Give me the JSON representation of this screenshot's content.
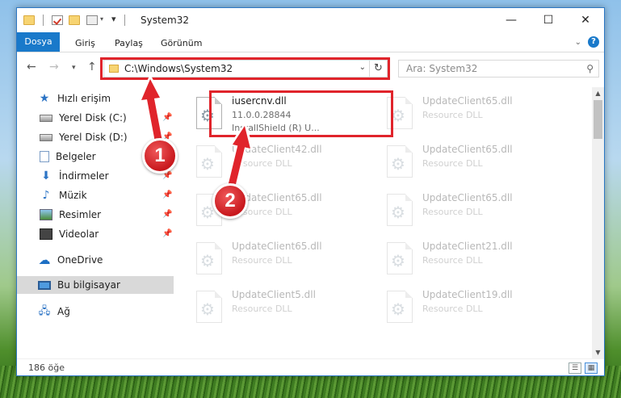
{
  "window": {
    "title": "System32"
  },
  "ribbon": {
    "tabs": [
      "Dosya",
      "Giriş",
      "Paylaş",
      "Görünüm"
    ]
  },
  "address": {
    "path": "C:\\Windows\\System32",
    "search_placeholder": "Ara: System32"
  },
  "sidebar": {
    "quick_access": "Hızlı erişim",
    "items": [
      {
        "label": "Yerel Disk (C:)",
        "icon": "disk-icon",
        "pinned": true
      },
      {
        "label": "Yerel Disk (D:)",
        "icon": "disk-icon",
        "pinned": true
      },
      {
        "label": "Belgeler",
        "icon": "documents-icon",
        "pinned": true
      },
      {
        "label": "İndirmeler",
        "icon": "download-icon",
        "pinned": true
      },
      {
        "label": "Müzik",
        "icon": "music-icon",
        "pinned": true
      },
      {
        "label": "Resimler",
        "icon": "pictures-icon",
        "pinned": true
      },
      {
        "label": "Videolar",
        "icon": "videos-icon",
        "pinned": true
      }
    ],
    "onedrive": "OneDrive",
    "this_pc": "Bu bilgisayar",
    "network": "Ağ"
  },
  "files": [
    {
      "name": "iusercnv.dll",
      "line2": "11.0.0.28844",
      "line3": "InstallShield (R) U...",
      "faded": false
    },
    {
      "name": "UpdateClient65.dll",
      "line2": "Resource DLL",
      "faded": true
    },
    {
      "name": "UpdateClient42.dll",
      "line2": "Resource DLL",
      "faded": true
    },
    {
      "name": "UpdateClient65.dll",
      "line2": "Resource DLL",
      "faded": true
    },
    {
      "name": "UpdateClient65.dll",
      "line2": "Resource DLL",
      "faded": true
    },
    {
      "name": "UpdateClient65.dll",
      "line2": "Resource DLL",
      "faded": true
    },
    {
      "name": "UpdateClient65.dll",
      "line2": "Resource DLL",
      "faded": true
    },
    {
      "name": "UpdateClient21.dll",
      "line2": "Resource DLL",
      "faded": true
    },
    {
      "name": "UpdateClient5.dll",
      "line2": "Resource DLL",
      "faded": true
    },
    {
      "name": "UpdateClient19.dll",
      "line2": "Resource DLL",
      "faded": true
    }
  ],
  "status": {
    "count": "186 öğe"
  },
  "annotations": {
    "step1": "1",
    "step2": "2"
  },
  "colors": {
    "accent": "#1979ca",
    "highlight": "#e0242b"
  }
}
